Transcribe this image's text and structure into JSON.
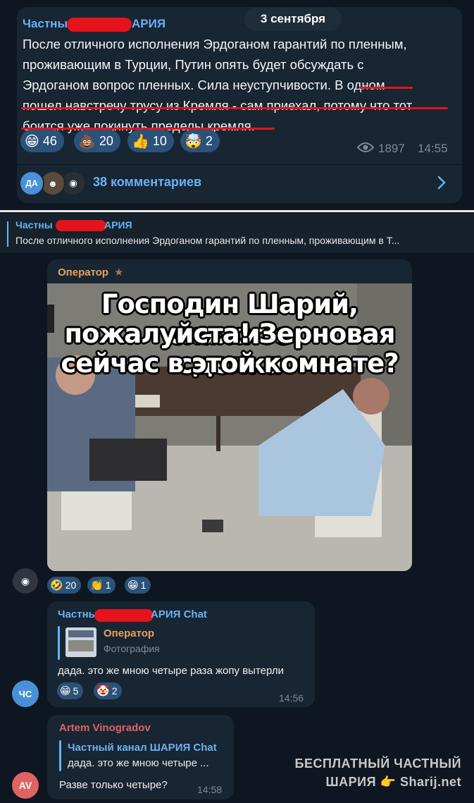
{
  "date_pill": "3 сентября",
  "post": {
    "channel_prefix": "Частны",
    "channel_suffix": "АРИЯ",
    "lines": [
      "После отличного исполнения Эрдоганом гарантий по пленным,",
      "проживающим в Турции, Путин опять будет обсуждать с",
      "Эрдоганом вопрос пленных. Сила неуступчивости. В одном",
      "пошел навстречу трусу из Кремля - сам приехал, потому что тот",
      "боится уже покинуть пределы кремля."
    ],
    "reactions": [
      {
        "emoji": "😁",
        "count": "46",
        "icon": "grin-emoji"
      },
      {
        "emoji": "💩",
        "count": "20",
        "icon": "poop-emoji"
      },
      {
        "emoji": "👍",
        "count": "10",
        "icon": "thumbs-up-emoji"
      },
      {
        "emoji": "🤯",
        "count": "2",
        "icon": "exploding-head-emoji"
      }
    ],
    "views": "1897",
    "time": "14:55",
    "comments_label": "38 комментариев",
    "comment_avatar_initials": "ДА"
  },
  "reply_header": {
    "prefix": "Частны",
    "suffix": "АРИЯ",
    "text": "После отличного исполнения Эрдоганом гарантий по пленным, проживающим в Т..."
  },
  "operator_msg": {
    "author": "Оператор",
    "meme_lines": [
      "Господин Шарий, скажите",
      "пожалуйста! Зерновая сделка",
      "сейчас в этой комнате?"
    ],
    "reactions": [
      {
        "emoji": "🤣",
        "count": "20",
        "icon": "rofl-emoji"
      },
      {
        "emoji": "👏",
        "count": "1",
        "icon": "clap-emoji"
      },
      {
        "emoji": "😁",
        "count": "1",
        "icon": "grin-emoji"
      }
    ]
  },
  "chat_msg": {
    "author_prefix": "Частны",
    "author_suffix": "АРИЯ Chat",
    "quote_author": "Оператор",
    "quote_text": "Фотография",
    "text": "дада. это же мною четыре раза жопу вытерли",
    "reactions": [
      {
        "emoji": "😁",
        "count": "5",
        "icon": "grin-emoji"
      },
      {
        "emoji": "🤡",
        "count": "2",
        "icon": "clown-emoji"
      }
    ],
    "time": "14:56",
    "avatar_initials": "ЧС"
  },
  "artem_msg": {
    "author": "Artem Vinogradov",
    "quote_author": "Частный канал ШАРИЯ Chat",
    "quote_text": "дада. это же мною четыре ...",
    "text": "Разве только четыре?",
    "time": "14:58",
    "avatar_initials": "AV"
  },
  "watermark": {
    "line1": "БЕСПЛАТНЫЙ ЧАСТНЫЙ",
    "line2_a": "ШАРИЯ",
    "line2_b": "Sharij.net"
  },
  "colors": {
    "background": "#0e1621",
    "bubble": "#182533",
    "accent": "#6ab2f2",
    "redaction": "#e5131b",
    "reaction_bg": "#2b5278"
  }
}
